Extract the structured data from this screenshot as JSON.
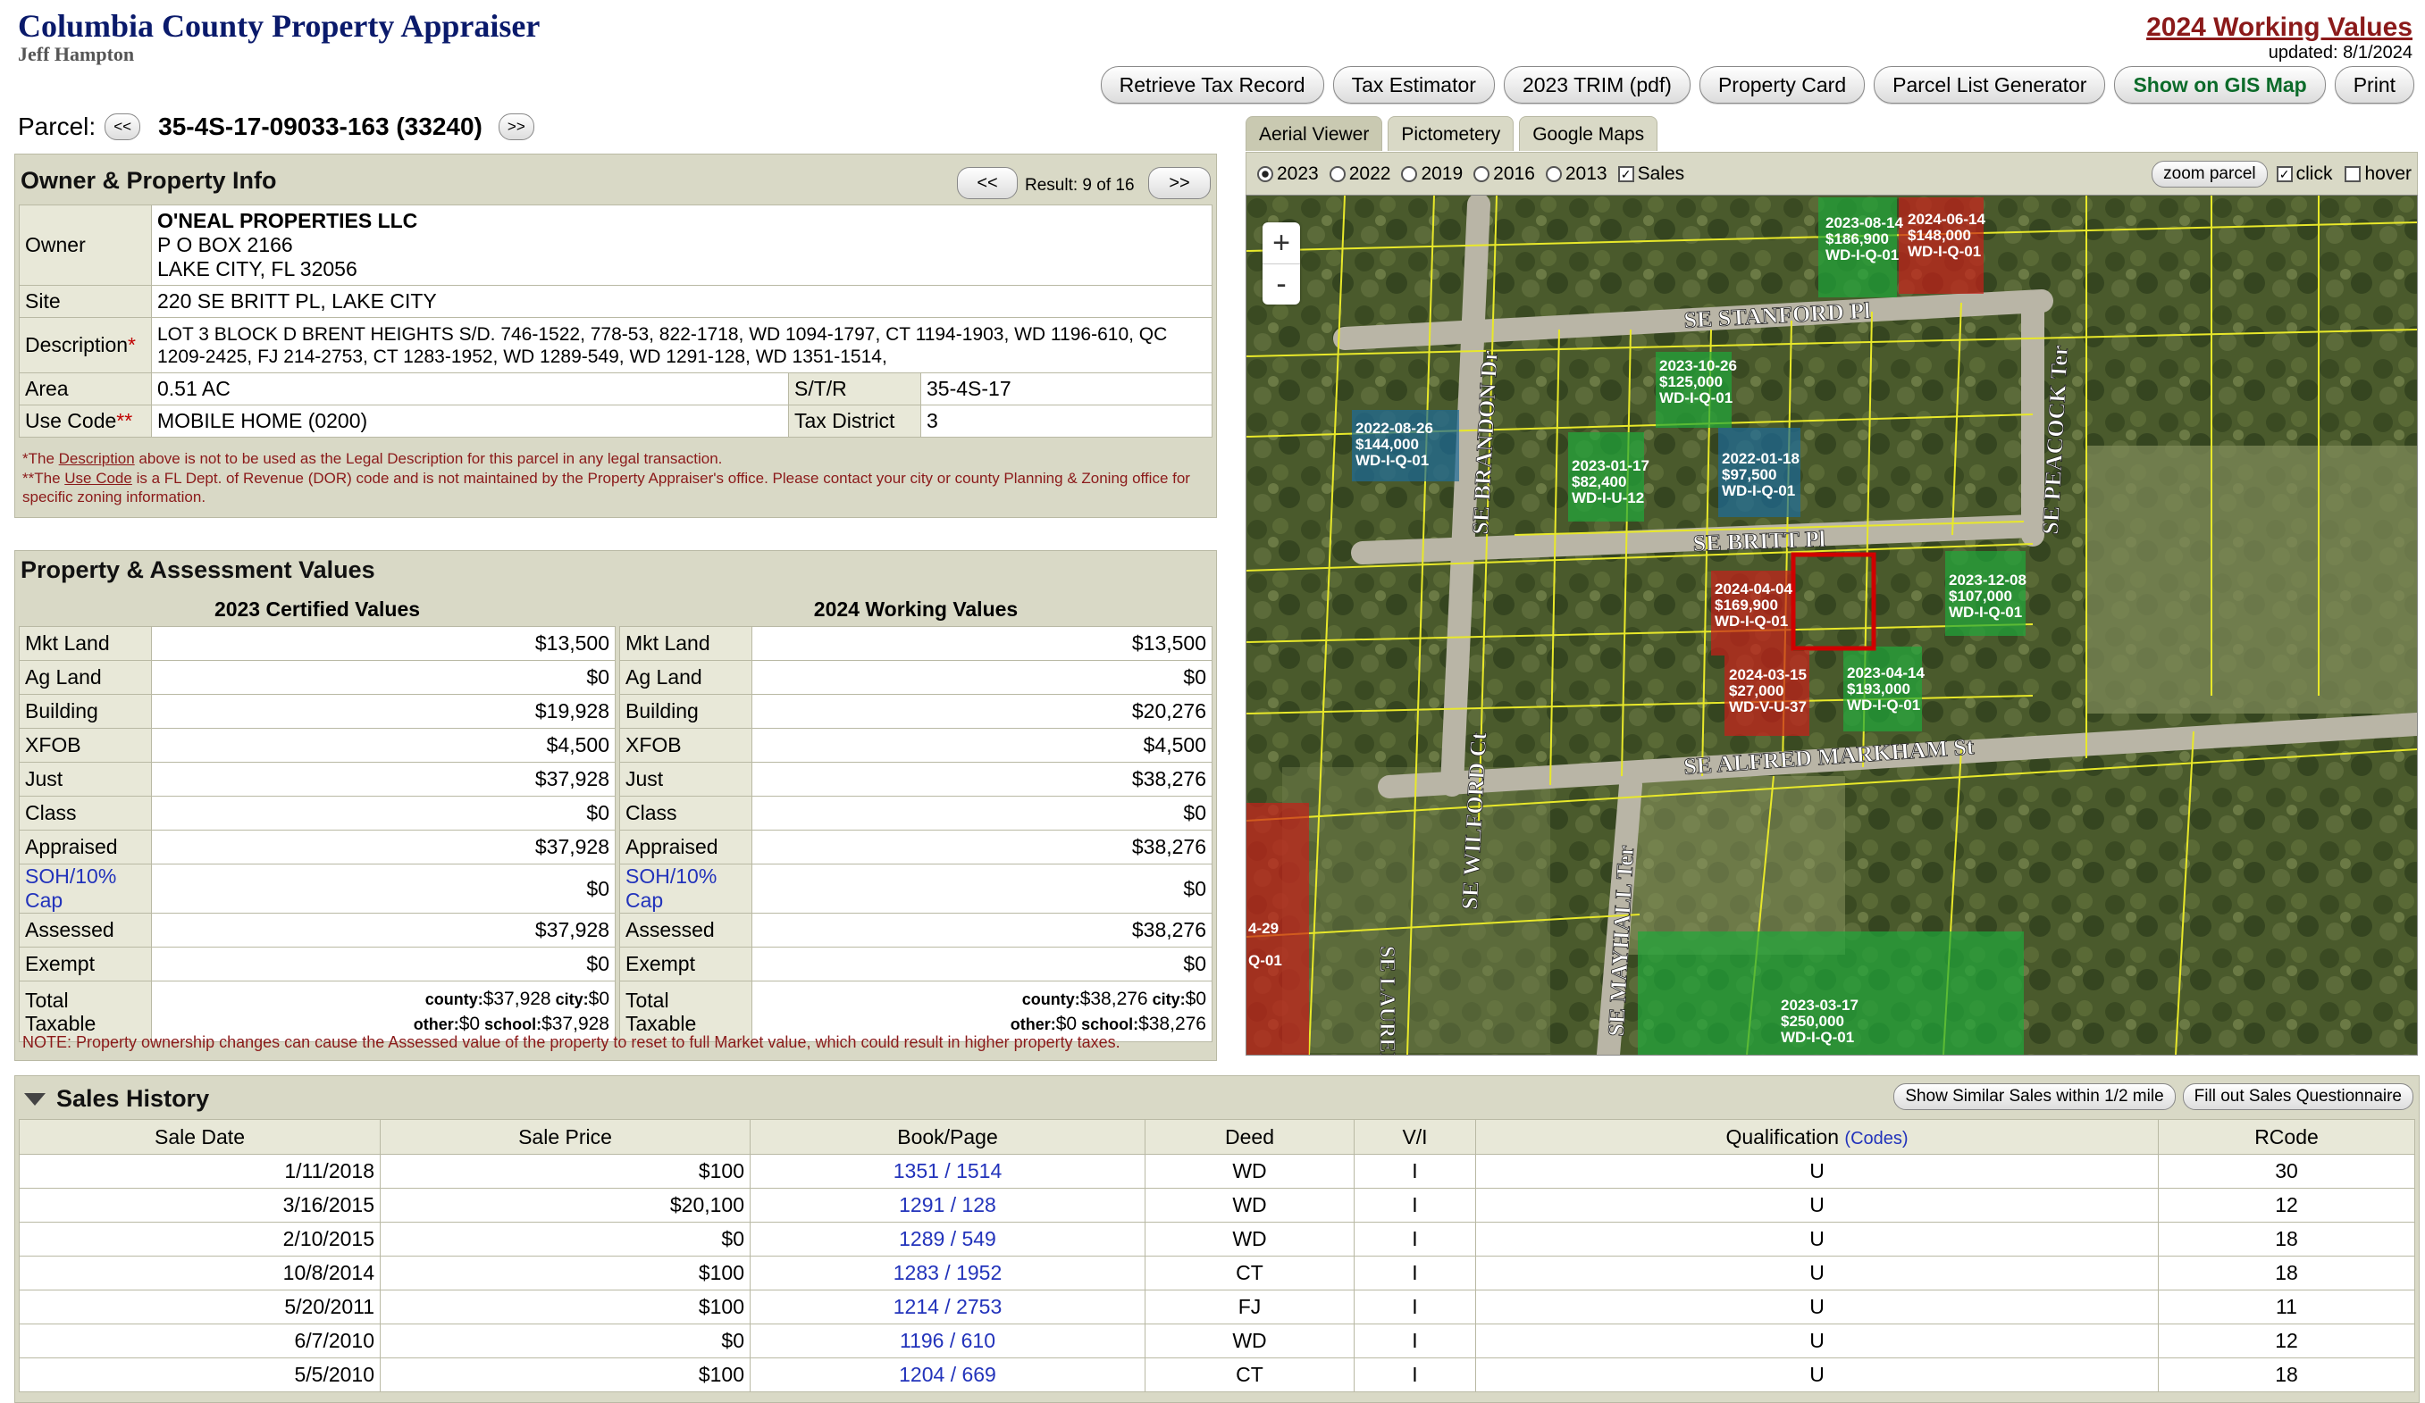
{
  "header": {
    "site_title": "Columbia County Property Appraiser",
    "appraiser_name": "Jeff Hampton",
    "working_values_title": "2024 Working Values",
    "updated": "updated: 8/1/2024"
  },
  "toolbar": {
    "buttons": [
      "Retrieve Tax Record",
      "Tax Estimator",
      "2023 TRIM (pdf)",
      "Property Card",
      "Parcel List Generator",
      "Show on GIS Map",
      "Print"
    ]
  },
  "parcel": {
    "label": "Parcel:",
    "prev": "<<",
    "next": ">>",
    "id": "35-4S-17-09033-163 (33240)"
  },
  "owner_panel": {
    "title": "Owner & Property Info",
    "prev": "<<",
    "next": ">>",
    "result": "Result: 9 of 16",
    "owner_label": "Owner",
    "owner_lines": [
      "O'NEAL PROPERTIES LLC",
      "P O BOX 2166",
      "LAKE CITY, FL 32056"
    ],
    "site_label": "Site",
    "site": "220 SE BRITT PL, LAKE CITY",
    "description_label": "Description",
    "description": "LOT 3 BLOCK D BRENT HEIGHTS S/D. 746-1522, 778-53, 822-1718, WD 1094-1797, CT 1194-1903, WD 1196-610, QC 1209-2425, FJ 214-2753, CT 1283-1952, WD 1289-549, WD 1291-128, WD 1351-1514,",
    "area_label": "Area",
    "area": "0.51 AC",
    "str_label": "S/T/R",
    "str": "35-4S-17",
    "use_code_label": "Use Code",
    "use_code": "MOBILE HOME (0200)",
    "tax_district_label": "Tax District",
    "tax_district": "3",
    "note1_prefix": "*The ",
    "note1_link": "Description",
    "note1_suffix": " above is not to be used as the Legal Description for this parcel in any legal transaction.",
    "note2_prefix": "**The ",
    "note2_link": "Use Code",
    "note2_suffix": " is a FL Dept. of Revenue (DOR) code and is not maintained by the Property Appraiser's office. Please contact your city or county Planning & Zoning office for specific zoning information."
  },
  "values_panel": {
    "title": "Property & Assessment Values",
    "col1_title": "2023 Certified Values",
    "col2_title": "2024 Working Values",
    "rows": [
      {
        "label": "Mkt Land",
        "v2023": "$13,500",
        "v2024": "$13,500"
      },
      {
        "label": "Ag Land",
        "v2023": "$0",
        "v2024": "$0"
      },
      {
        "label": "Building",
        "v2023": "$19,928",
        "v2024": "$20,276"
      },
      {
        "label": "XFOB",
        "v2023": "$4,500",
        "v2024": "$4,500"
      },
      {
        "label": "Just",
        "v2023": "$37,928",
        "v2024": "$38,276"
      },
      {
        "label": "Class",
        "v2023": "$0",
        "v2024": "$0"
      },
      {
        "label": "Appraised",
        "v2023": "$37,928",
        "v2024": "$38,276"
      },
      {
        "label": "SOH/10% Cap",
        "v2023": "$0",
        "v2024": "$0"
      },
      {
        "label": "Assessed",
        "v2023": "$37,928",
        "v2024": "$38,276"
      },
      {
        "label": "Exempt",
        "v2023": "$0",
        "v2024": "$0"
      }
    ],
    "total_label_1": "Total",
    "total_label_2": "Taxable",
    "t2023_line1_county_k": "county:",
    "t2023_line1_county_v": "$37,928",
    "t2023_line1_city_k": " city:",
    "t2023_line1_city_v": "$0",
    "t2023_line2_other_k": "other:",
    "t2023_line2_other_v": "$0",
    "t2023_line2_school_k": " school:",
    "t2023_line2_school_v": "$37,928",
    "t2024_line1_county_k": "county:",
    "t2024_line1_county_v": "$38,276",
    "t2024_line1_city_k": " city:",
    "t2024_line1_city_v": "$0",
    "t2024_line2_other_k": "other:",
    "t2024_line2_other_v": "$0",
    "t2024_line2_school_k": " school:",
    "t2024_line2_school_v": "$38,276",
    "note": "NOTE: Property ownership changes can cause the Assessed value of the property to reset to full Market value, which could result in higher property taxes."
  },
  "map": {
    "tabs": [
      "Aerial Viewer",
      "Pictometery",
      "Google Maps"
    ],
    "years": [
      "2023",
      "2022",
      "2019",
      "2016",
      "2013"
    ],
    "sales_label": "Sales",
    "zoom_parcel": "zoom parcel",
    "click_label": "click",
    "hover_label": "hover",
    "zoom_in": "+",
    "zoom_out": "-",
    "streets": {
      "stanford": "SE STANFORD Pl",
      "britt": "SE BRITT Pl",
      "alfred": "SE ALFRED MARKHAM St",
      "brandon": "SE BRANDON Dr",
      "peacock": "SE PEACOCK Ter",
      "wilford": "SE WILFORD Ct",
      "laurence": "SE LAURENCE Ct",
      "mayhall": "SE MAYHALL Ter"
    },
    "sale_labels": [
      {
        "date": "2023-08-14",
        "price": "$186,900",
        "code": "WD-I-Q-01"
      },
      {
        "date": "2024-06-14",
        "price": "$148,000",
        "code": "WD-I-Q-01"
      },
      {
        "date": "2023-10-26",
        "price": "$125,000",
        "code": "WD-I-Q-01"
      },
      {
        "date": "2022-08-26",
        "price": "$144,000",
        "code": "WD-I-Q-01"
      },
      {
        "date": "2023-01-17",
        "price": "$82,400",
        "code": "WD-I-U-12"
      },
      {
        "date": "2022-01-18",
        "price": "$97,500",
        "code": "WD-I-Q-01"
      },
      {
        "date": "2024-04-04",
        "price": "$169,900",
        "code": "WD-I-Q-01"
      },
      {
        "date": "2023-12-08",
        "price": "$107,000",
        "code": "WD-I-Q-01"
      },
      {
        "date": "2024-03-15",
        "price": "$27,000",
        "code": "WD-V-U-37"
      },
      {
        "date": "2023-04-14",
        "price": "$193,000",
        "code": "WD-I-Q-01"
      },
      {
        "date": "2023-03-17",
        "price": "$250,000",
        "code": "WD-I-Q-01"
      },
      {
        "date": "4-29",
        "price": "",
        "code": "Q-01"
      }
    ]
  },
  "sales": {
    "title": "Sales History",
    "similar_btn": "Show Similar Sales within 1/2 mile",
    "questionnaire_btn": "Fill out Sales Questionnaire",
    "headers": {
      "date": "Sale Date",
      "price": "Sale Price",
      "book": "Book/Page",
      "deed": "Deed",
      "vi": "V/I",
      "qual": "Qualification",
      "codes": "(Codes)",
      "rcode": "RCode"
    },
    "rows": [
      {
        "date": "1/11/2018",
        "price": "$100",
        "book": "1351 / 1514",
        "deed": "WD",
        "vi": "I",
        "qual": "U",
        "rcode": "30"
      },
      {
        "date": "3/16/2015",
        "price": "$20,100",
        "book": "1291 / 128",
        "deed": "WD",
        "vi": "I",
        "qual": "U",
        "rcode": "12"
      },
      {
        "date": "2/10/2015",
        "price": "$0",
        "book": "1289 / 549",
        "deed": "WD",
        "vi": "I",
        "qual": "U",
        "rcode": "18"
      },
      {
        "date": "10/8/2014",
        "price": "$100",
        "book": "1283 / 1952",
        "deed": "CT",
        "vi": "I",
        "qual": "U",
        "rcode": "18"
      },
      {
        "date": "5/20/2011",
        "price": "$100",
        "book": "1214 / 2753",
        "deed": "FJ",
        "vi": "I",
        "qual": "U",
        "rcode": "11"
      },
      {
        "date": "6/7/2010",
        "price": "$0",
        "book": "1196 / 610",
        "deed": "WD",
        "vi": "I",
        "qual": "U",
        "rcode": "12"
      },
      {
        "date": "5/5/2010",
        "price": "$100",
        "book": "1204 / 669",
        "deed": "CT",
        "vi": "I",
        "qual": "U",
        "rcode": "18"
      }
    ]
  }
}
